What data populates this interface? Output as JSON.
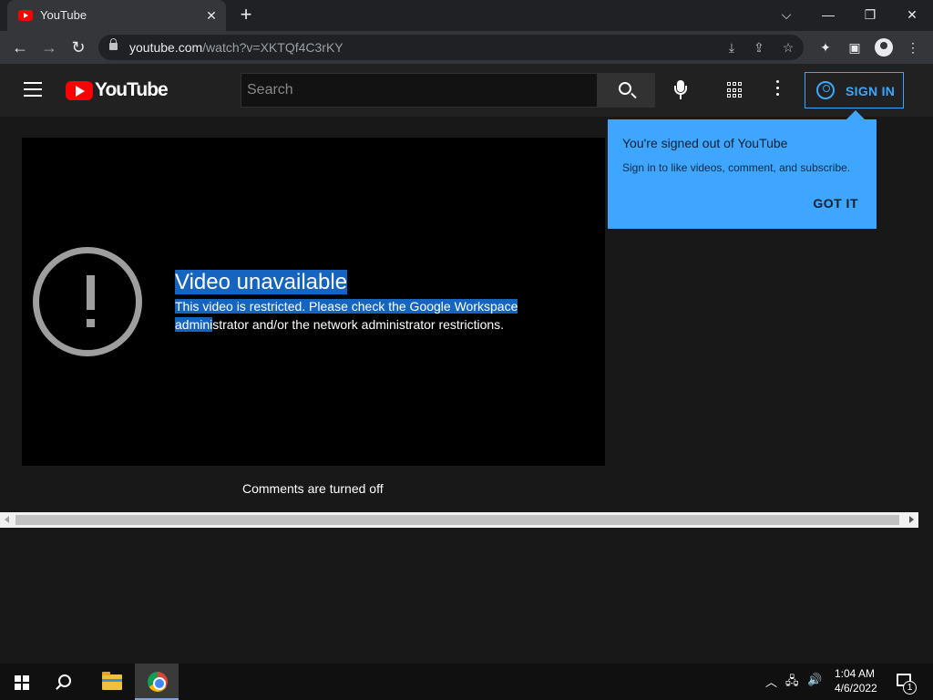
{
  "browser": {
    "tab_title": "YouTube",
    "tab_close": "✕",
    "new_tab": "+",
    "window_controls": {
      "tab_search": "⌵",
      "minimize": "—",
      "restore": "❐",
      "close": "✕"
    },
    "nav": {
      "back": "←",
      "forward": "→",
      "reload": "↻"
    },
    "url_host": "youtube.com",
    "url_path": "/watch?v=XKTQf4C3rKY",
    "icons": [
      "install-icon",
      "share-icon",
      "star-icon",
      "extensions-icon",
      "side-panel-icon",
      "profile-icon",
      "menu-icon"
    ]
  },
  "youtube": {
    "wordmark": "YouTube",
    "search_placeholder": "Search",
    "sign_in_label": "SIGN IN",
    "accent_color": "#3ea6ff"
  },
  "player": {
    "error_title": "Video unavailable",
    "error_msg_highlight": "This video is restricted. Please check the Google Workspace admini",
    "error_msg_rest": "strator and/or the network administrator restrictions."
  },
  "comments_status": "Comments are turned off",
  "tooltip": {
    "title": "You're signed out of YouTube",
    "body": "Sign in to like videos, comment, and subscribe.",
    "button": "GOT IT"
  },
  "taskbar": {
    "tray_chevron": "︿",
    "network": "🖧",
    "volume": "🔊",
    "time": "1:04 AM",
    "date": "4/6/2022",
    "notification_count": "1"
  }
}
